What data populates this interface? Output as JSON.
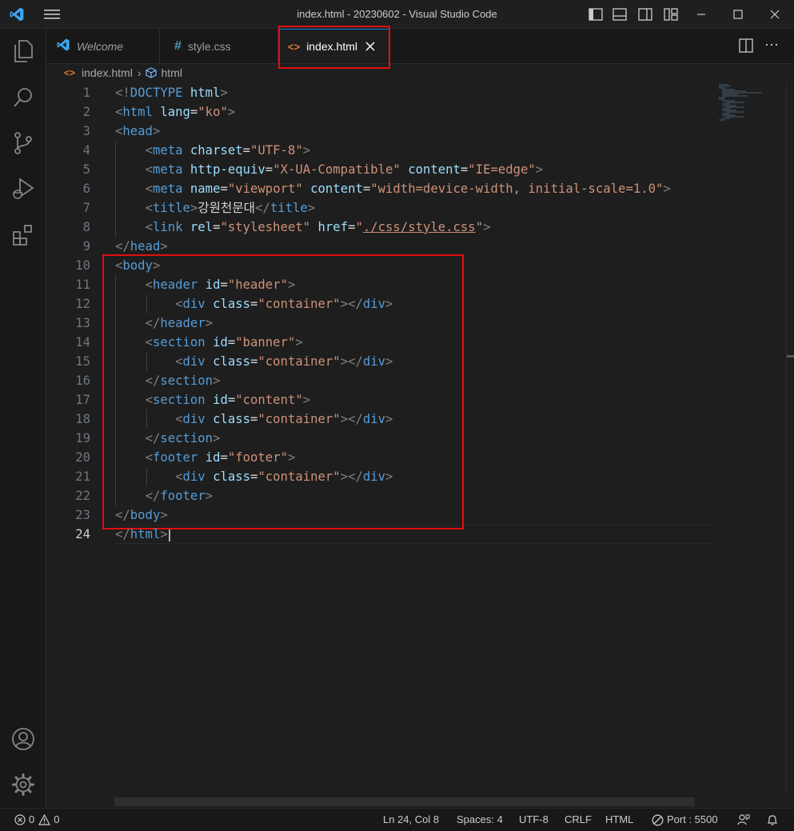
{
  "window": {
    "title": "index.html - 20230602 - Visual Studio Code"
  },
  "tabs": [
    {
      "label": "Welcome",
      "icon": "vscode-logo-icon"
    },
    {
      "label": "style.css",
      "icon": "hash-icon"
    },
    {
      "label": "index.html",
      "icon": "html-file-icon"
    }
  ],
  "breadcrumb": {
    "file": "index.html",
    "element": "html"
  },
  "code": {
    "line_numbers": [
      "1",
      "2",
      "3",
      "4",
      "5",
      "6",
      "7",
      "8",
      "9",
      "10",
      "11",
      "12",
      "13",
      "14",
      "15",
      "16",
      "17",
      "18",
      "19",
      "20",
      "21",
      "22",
      "23",
      "24"
    ],
    "current_line": "24",
    "lines": [
      [
        [
          "br",
          "<!"
        ],
        [
          "tag",
          "DOCTYPE"
        ],
        [
          "txt",
          " "
        ],
        [
          "attr",
          "html"
        ],
        [
          "br",
          ">"
        ]
      ],
      [
        [
          "br",
          "<"
        ],
        [
          "tag",
          "html"
        ],
        [
          "txt",
          " "
        ],
        [
          "attr",
          "lang"
        ],
        [
          "txt",
          "="
        ],
        [
          "str",
          "\"ko\""
        ],
        [
          "br",
          ">"
        ]
      ],
      [
        [
          "br",
          "<"
        ],
        [
          "tag",
          "head"
        ],
        [
          "br",
          ">"
        ]
      ],
      [
        [
          "txt",
          "    "
        ],
        [
          "br",
          "<"
        ],
        [
          "tag",
          "meta"
        ],
        [
          "txt",
          " "
        ],
        [
          "attr",
          "charset"
        ],
        [
          "txt",
          "="
        ],
        [
          "str",
          "\"UTF-8\""
        ],
        [
          "br",
          ">"
        ]
      ],
      [
        [
          "txt",
          "    "
        ],
        [
          "br",
          "<"
        ],
        [
          "tag",
          "meta"
        ],
        [
          "txt",
          " "
        ],
        [
          "attr",
          "http-equiv"
        ],
        [
          "txt",
          "="
        ],
        [
          "str",
          "\"X-UA-Compatible\""
        ],
        [
          "txt",
          " "
        ],
        [
          "attr",
          "content"
        ],
        [
          "txt",
          "="
        ],
        [
          "str",
          "\"IE=edge\""
        ],
        [
          "br",
          ">"
        ]
      ],
      [
        [
          "txt",
          "    "
        ],
        [
          "br",
          "<"
        ],
        [
          "tag",
          "meta"
        ],
        [
          "txt",
          " "
        ],
        [
          "attr",
          "name"
        ],
        [
          "txt",
          "="
        ],
        [
          "str",
          "\"viewport\""
        ],
        [
          "txt",
          " "
        ],
        [
          "attr",
          "content"
        ],
        [
          "txt",
          "="
        ],
        [
          "str",
          "\"width=device-width, initial-scale=1.0\""
        ],
        [
          "br",
          ">"
        ]
      ],
      [
        [
          "txt",
          "    "
        ],
        [
          "br",
          "<"
        ],
        [
          "tag",
          "title"
        ],
        [
          "br",
          ">"
        ],
        [
          "txt",
          "강원천문대"
        ],
        [
          "br",
          "</"
        ],
        [
          "tag",
          "title"
        ],
        [
          "br",
          ">"
        ]
      ],
      [
        [
          "txt",
          "    "
        ],
        [
          "br",
          "<"
        ],
        [
          "tag",
          "link"
        ],
        [
          "txt",
          " "
        ],
        [
          "attr",
          "rel"
        ],
        [
          "txt",
          "="
        ],
        [
          "str",
          "\"stylesheet\""
        ],
        [
          "txt",
          " "
        ],
        [
          "attr",
          "href"
        ],
        [
          "txt",
          "="
        ],
        [
          "str",
          "\""
        ],
        [
          "link",
          "./css/style.css"
        ],
        [
          "str",
          "\""
        ],
        [
          "br",
          ">"
        ]
      ],
      [
        [
          "br",
          "</"
        ],
        [
          "tag",
          "head"
        ],
        [
          "br",
          ">"
        ]
      ],
      [
        [
          "br",
          "<"
        ],
        [
          "tag",
          "body"
        ],
        [
          "br",
          ">"
        ]
      ],
      [
        [
          "txt",
          "    "
        ],
        [
          "br",
          "<"
        ],
        [
          "tag",
          "header"
        ],
        [
          "txt",
          " "
        ],
        [
          "attr",
          "id"
        ],
        [
          "txt",
          "="
        ],
        [
          "str",
          "\"header\""
        ],
        [
          "br",
          ">"
        ]
      ],
      [
        [
          "txt",
          "        "
        ],
        [
          "br",
          "<"
        ],
        [
          "tag",
          "div"
        ],
        [
          "txt",
          " "
        ],
        [
          "attr",
          "class"
        ],
        [
          "txt",
          "="
        ],
        [
          "str",
          "\"container\""
        ],
        [
          "br",
          "></"
        ],
        [
          "tag",
          "div"
        ],
        [
          "br",
          ">"
        ]
      ],
      [
        [
          "txt",
          "    "
        ],
        [
          "br",
          "</"
        ],
        [
          "tag",
          "header"
        ],
        [
          "br",
          ">"
        ]
      ],
      [
        [
          "txt",
          "    "
        ],
        [
          "br",
          "<"
        ],
        [
          "tag",
          "section"
        ],
        [
          "txt",
          " "
        ],
        [
          "attr",
          "id"
        ],
        [
          "txt",
          "="
        ],
        [
          "str",
          "\"banner\""
        ],
        [
          "br",
          ">"
        ]
      ],
      [
        [
          "txt",
          "        "
        ],
        [
          "br",
          "<"
        ],
        [
          "tag",
          "div"
        ],
        [
          "txt",
          " "
        ],
        [
          "attr",
          "class"
        ],
        [
          "txt",
          "="
        ],
        [
          "str",
          "\"container\""
        ],
        [
          "br",
          "></"
        ],
        [
          "tag",
          "div"
        ],
        [
          "br",
          ">"
        ]
      ],
      [
        [
          "txt",
          "    "
        ],
        [
          "br",
          "</"
        ],
        [
          "tag",
          "section"
        ],
        [
          "br",
          ">"
        ]
      ],
      [
        [
          "txt",
          "    "
        ],
        [
          "br",
          "<"
        ],
        [
          "tag",
          "section"
        ],
        [
          "txt",
          " "
        ],
        [
          "attr",
          "id"
        ],
        [
          "txt",
          "="
        ],
        [
          "str",
          "\"content\""
        ],
        [
          "br",
          ">"
        ]
      ],
      [
        [
          "txt",
          "        "
        ],
        [
          "br",
          "<"
        ],
        [
          "tag",
          "div"
        ],
        [
          "txt",
          " "
        ],
        [
          "attr",
          "class"
        ],
        [
          "txt",
          "="
        ],
        [
          "str",
          "\"container\""
        ],
        [
          "br",
          "></"
        ],
        [
          "tag",
          "div"
        ],
        [
          "br",
          ">"
        ]
      ],
      [
        [
          "txt",
          "    "
        ],
        [
          "br",
          "</"
        ],
        [
          "tag",
          "section"
        ],
        [
          "br",
          ">"
        ]
      ],
      [
        [
          "txt",
          "    "
        ],
        [
          "br",
          "<"
        ],
        [
          "tag",
          "footer"
        ],
        [
          "txt",
          " "
        ],
        [
          "attr",
          "id"
        ],
        [
          "txt",
          "="
        ],
        [
          "str",
          "\"footer\""
        ],
        [
          "br",
          ">"
        ]
      ],
      [
        [
          "txt",
          "        "
        ],
        [
          "br",
          "<"
        ],
        [
          "tag",
          "div"
        ],
        [
          "txt",
          " "
        ],
        [
          "attr",
          "class"
        ],
        [
          "txt",
          "="
        ],
        [
          "str",
          "\"container\""
        ],
        [
          "br",
          "></"
        ],
        [
          "tag",
          "div"
        ],
        [
          "br",
          ">"
        ]
      ],
      [
        [
          "txt",
          "    "
        ],
        [
          "br",
          "</"
        ],
        [
          "tag",
          "footer"
        ],
        [
          "br",
          ">"
        ]
      ],
      [
        [
          "br",
          "</"
        ],
        [
          "tag",
          "body"
        ],
        [
          "br",
          ">"
        ]
      ],
      [
        [
          "br",
          "</"
        ],
        [
          "tag",
          "html"
        ],
        [
          "br",
          ">"
        ]
      ]
    ]
  },
  "status": {
    "errors": "0",
    "warnings": "0",
    "position": "Ln 24, Col 8",
    "spaces": "Spaces: 4",
    "encoding": "UTF-8",
    "eol": "CRLF",
    "language": "HTML",
    "port": "Port : 5500"
  },
  "colors": {
    "highlight": "#e01010",
    "tag": "#569cd6",
    "attr": "#9cdcfe",
    "string": "#ce9178"
  }
}
